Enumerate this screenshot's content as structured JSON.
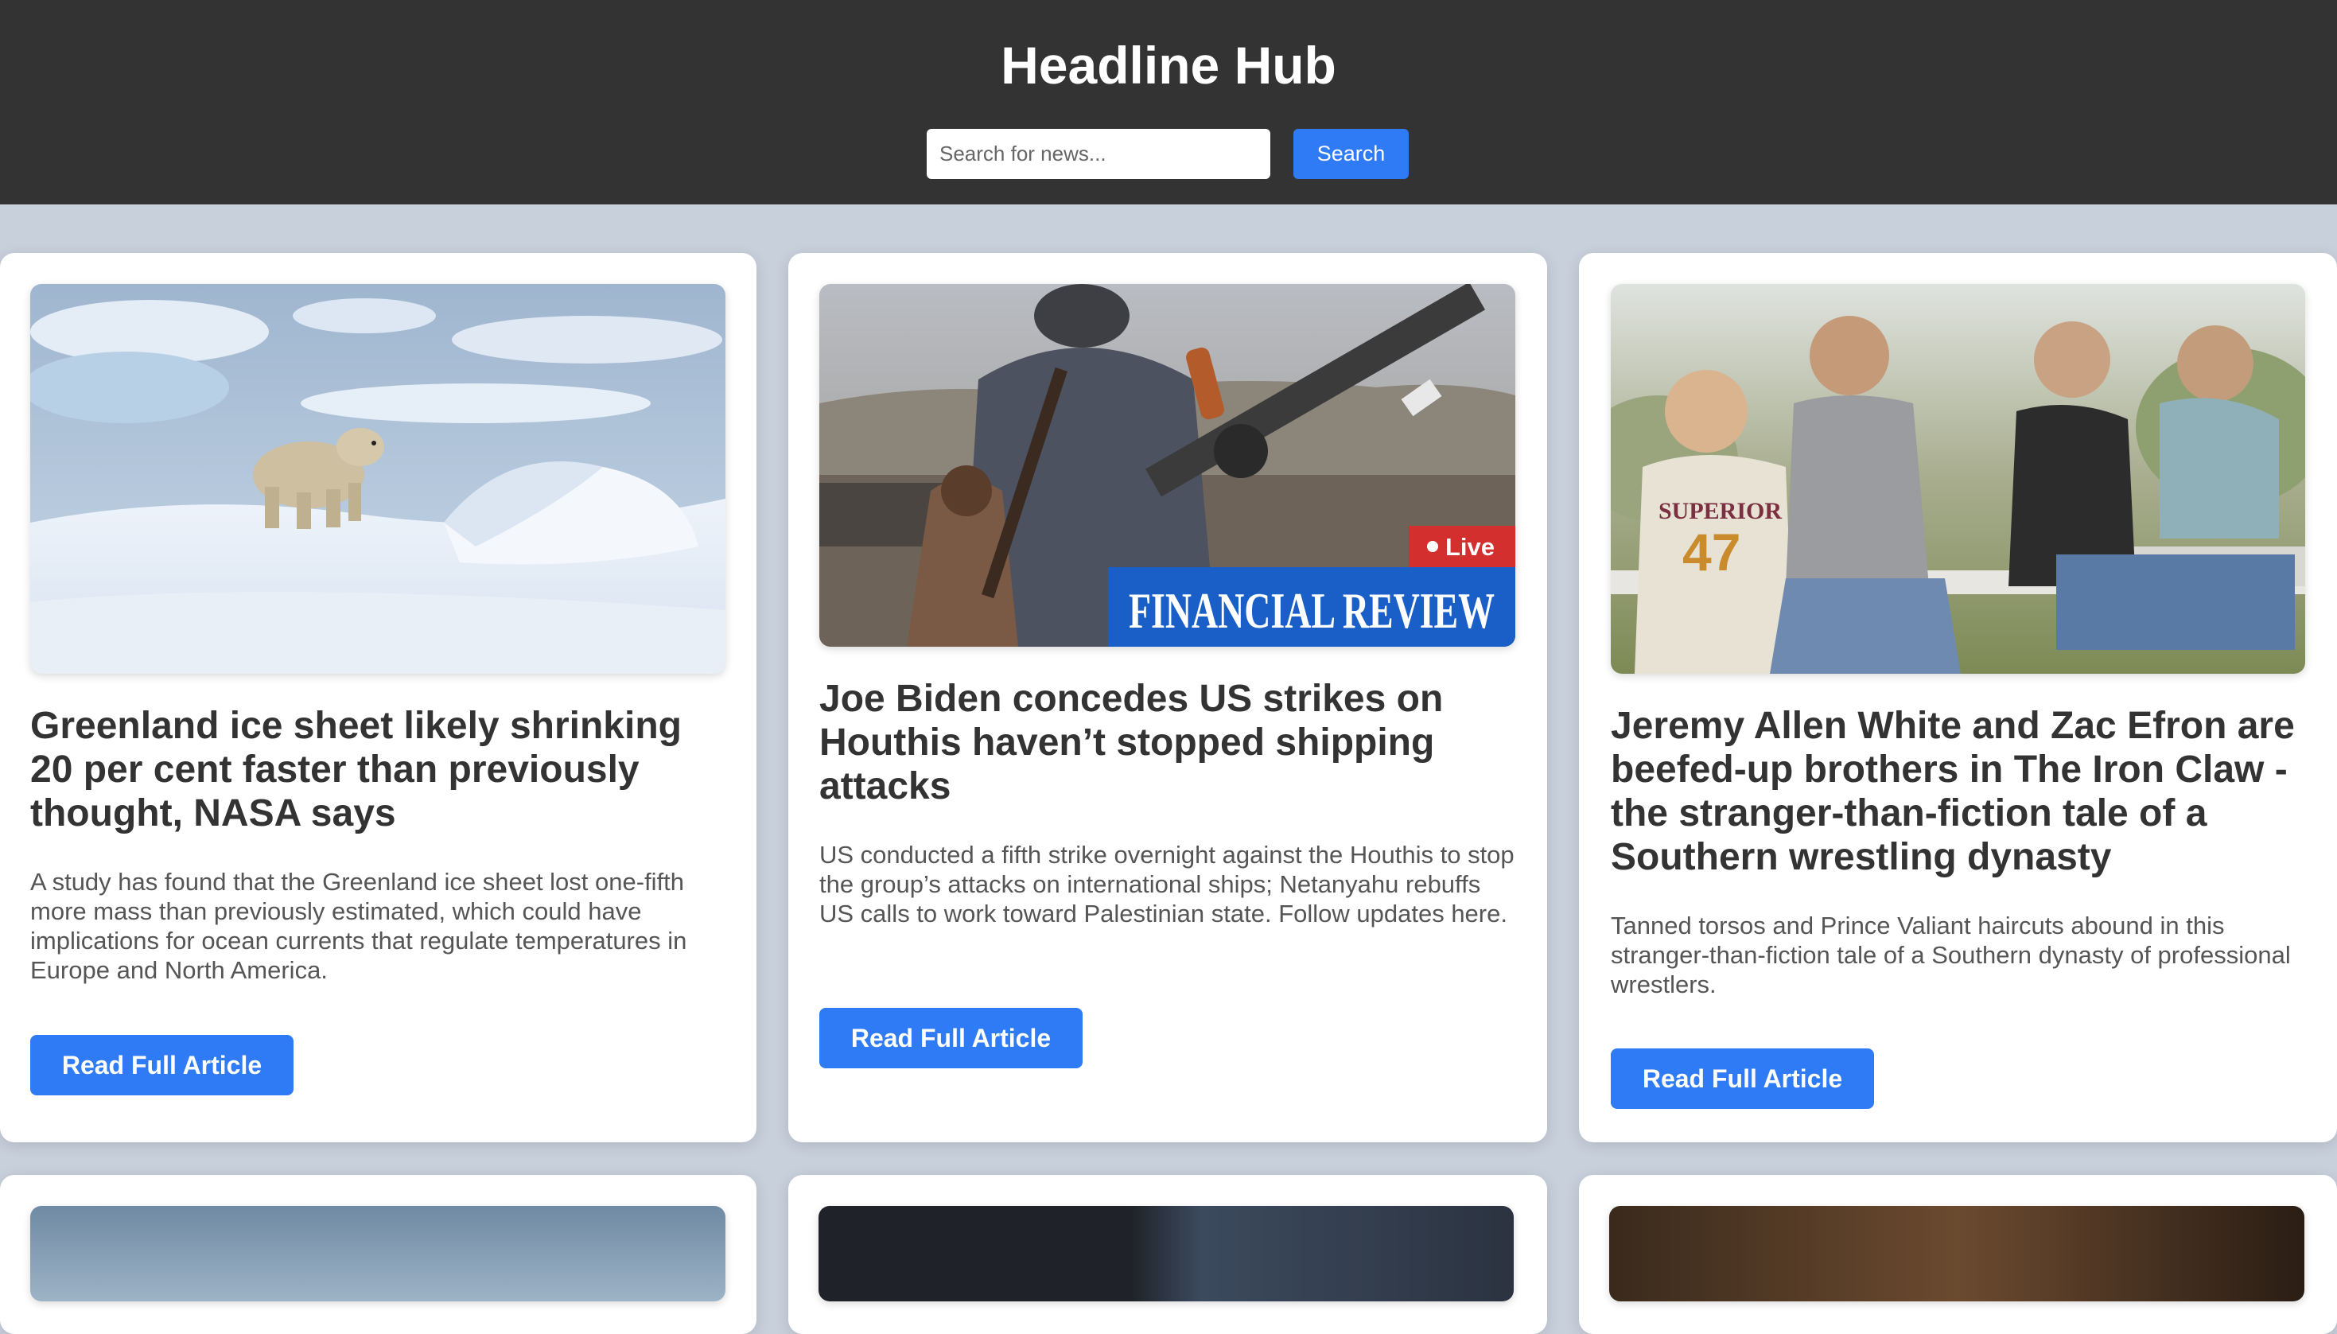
{
  "header": {
    "title": "Headline Hub",
    "search_placeholder": "Search for news...",
    "search_button_label": "Search"
  },
  "articles": [
    {
      "title": "Greenland ice sheet likely shrinking 20 per cent faster than previously thought, NASA says",
      "description": "A study has found that the Greenland ice sheet lost one-fifth more mass than previously estimated, which could have implications for ocean currents that regulate temperatures in Europe and North America.",
      "button_label": "Read Full Article",
      "image": "polar-bear-on-ice-photo"
    },
    {
      "title": "Joe Biden concedes US strikes on Houthis haven’t stopped shipping attacks",
      "description": "US conducted a fifth strike overnight against the Houthis to stop the group’s attacks on international ships; Netanyahu rebuffs US calls to work toward Palestinian state. Follow updates here.",
      "button_label": "Read Full Article",
      "image": "armed-fighters-photo",
      "image_badge": "Live",
      "image_banner": "FINANCIAL REVIEW"
    },
    {
      "title": "Jeremy Allen White and Zac Efron are beefed-up brothers in The Iron Claw - the stranger-than-fiction tale of a Southern wrestling dynasty",
      "description": "Tanned torsos and Prince Valiant haircuts abound in this stranger-than-fiction tale of a Southern dynasty of professional wrestlers.",
      "button_label": "Read Full Article",
      "image": "four-brothers-on-fence-photo",
      "image_jersey_text": "SUPERIOR",
      "image_jersey_number": "47"
    }
  ],
  "colors": {
    "header_bg": "#333333",
    "page_bg": "#c8d0dc",
    "accent": "#2f7bf5",
    "live_badge": "#d32f2f",
    "banner_blue": "#1a5fc8"
  }
}
